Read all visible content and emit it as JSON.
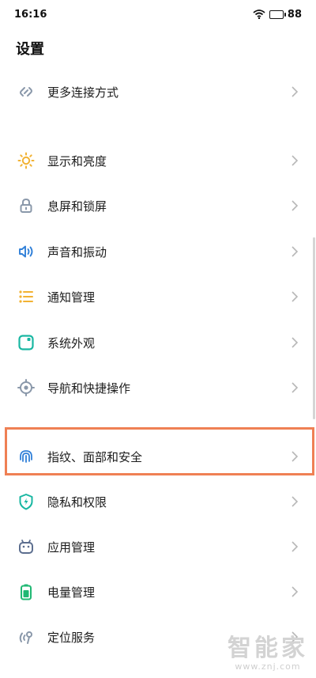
{
  "status_bar": {
    "time": "16:16",
    "battery": "88"
  },
  "page": {
    "title": "设置"
  },
  "settings": {
    "more_connections": "更多连接方式",
    "display_brightness": "显示和亮度",
    "screen_lock": "息屏和锁屏",
    "sound_vibration": "声音和振动",
    "notifications": "通知管理",
    "system_appearance": "系统外观",
    "navigation_shortcuts": "导航和快捷操作",
    "fingerprint_face_security": "指纹、面部和安全",
    "privacy_permissions": "隐私和权限",
    "app_management": "应用管理",
    "battery_management": "电量管理",
    "location_services": "定位服务"
  },
  "watermark": {
    "logo": "智能家",
    "url": "www.znj.com"
  },
  "colors": {
    "highlight": "#ef8054",
    "accent_yellow": "#f2b233",
    "accent_blue": "#2f7fd8",
    "accent_teal": "#19b7a2",
    "accent_green": "#1fb873"
  }
}
